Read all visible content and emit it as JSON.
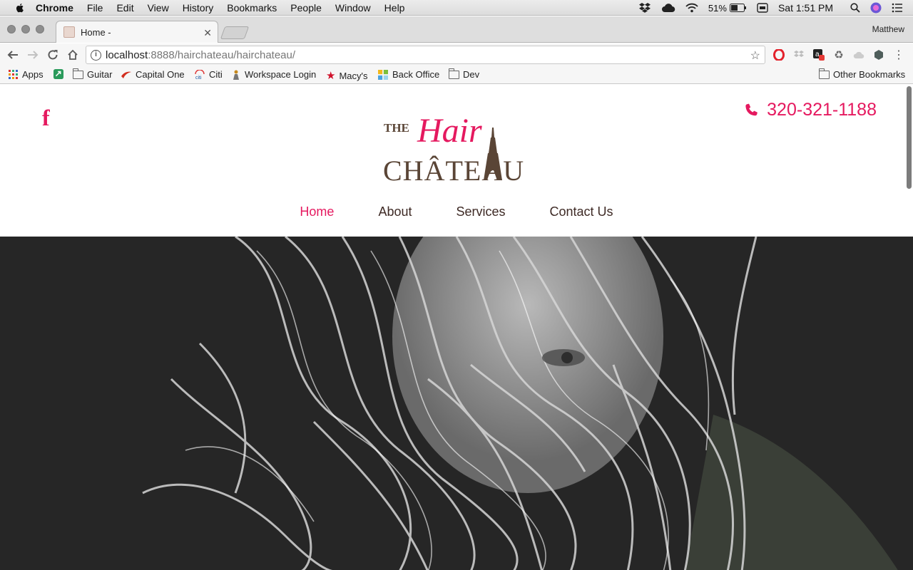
{
  "menubar": {
    "app": "Chrome",
    "items": [
      "File",
      "Edit",
      "View",
      "History",
      "Bookmarks",
      "People",
      "Window",
      "Help"
    ],
    "battery": "51%",
    "clock": "Sat 1:51 PM"
  },
  "tabbar": {
    "tab_title": "Home -",
    "user": "Matthew"
  },
  "omnibox": {
    "host": "localhost",
    "path": ":8888/hairchateau/hairchateau/"
  },
  "bookmarks": {
    "apps": "Apps",
    "guitar": "Guitar",
    "capital_one": "Capital One",
    "citi": "Citi",
    "workspace": "Workspace Login",
    "macys": "Macy's",
    "back_office": "Back Office",
    "dev": "Dev",
    "other": "Other Bookmarks"
  },
  "site": {
    "phone": "320-321-1188",
    "logo_the": "THE",
    "logo_hair": "Hair",
    "logo_chateau": "CHÂTEAU",
    "nav": [
      "Home",
      "About",
      "Services",
      "Contact Us"
    ],
    "accent_color": "#e5195f",
    "brown_color": "#5a4536"
  }
}
